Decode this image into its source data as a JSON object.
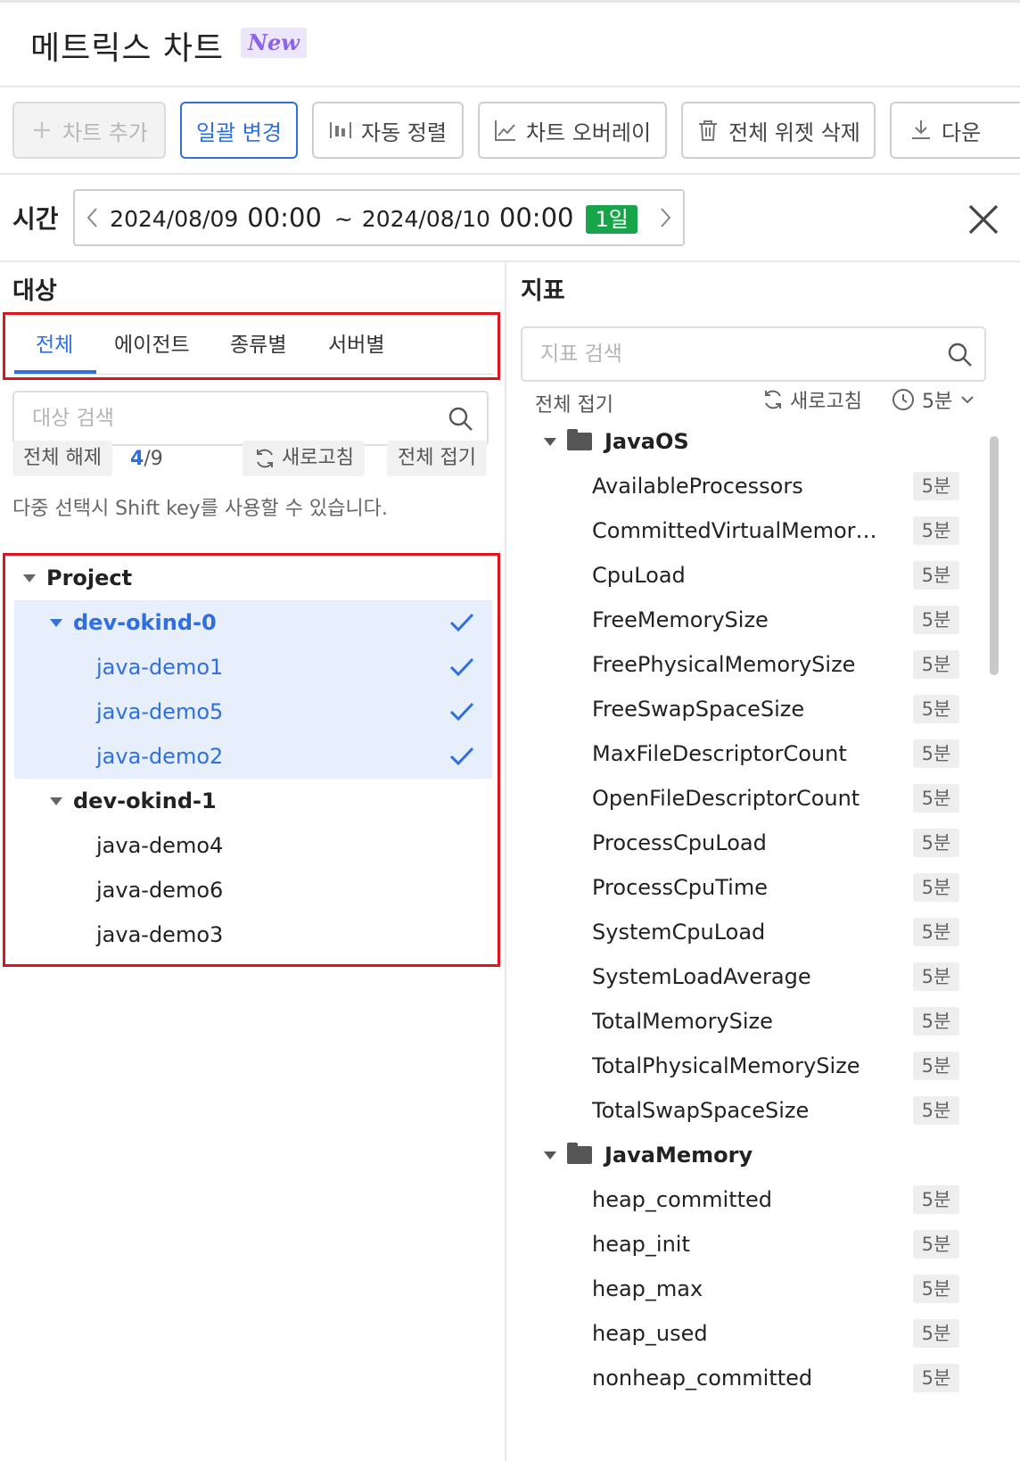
{
  "header": {
    "title": "메트릭스 차트",
    "badge": "New"
  },
  "toolbar": {
    "add_chart": "차트 추가",
    "bulk_change": "일괄 변경",
    "auto_sort": "자동 정렬",
    "chart_overlay": "차트 오버레이",
    "delete_all_widgets": "전체 위젯 삭제",
    "download": "다운"
  },
  "time": {
    "label": "시간",
    "start_date": "2024/08/09",
    "start_hm": "00:00",
    "separator": "~",
    "end_date": "2024/08/10",
    "end_hm": "00:00",
    "range_badge": "1일"
  },
  "target": {
    "title": "대상",
    "tabs": [
      "전체",
      "에이전트",
      "종류별",
      "서버별"
    ],
    "search_placeholder": "대상 검색",
    "deselect_all": "전체 해제",
    "count_selected": "4",
    "count_total": "/9",
    "refresh": "새로고침",
    "collapse_all": "전체 접기",
    "hint": "다중 선택시 Shift key를 사용할 수 있습니다.",
    "tree": {
      "root": "Project",
      "groups": [
        {
          "name": "dev-okind-0",
          "items": [
            "java-demo1",
            "java-demo5",
            "java-demo2"
          ]
        },
        {
          "name": "dev-okind-1",
          "items": [
            "java-demo4",
            "java-demo6",
            "java-demo3"
          ]
        }
      ]
    }
  },
  "metrics": {
    "title": "지표",
    "search_placeholder": "지표 검색",
    "collapse_all": "전체 접기",
    "refresh": "새로고침",
    "interval": "5분",
    "groups": [
      {
        "name": "JavaOS",
        "items": [
          "AvailableProcessors",
          "CommittedVirtualMemoryS...",
          "CpuLoad",
          "FreeMemorySize",
          "FreePhysicalMemorySize",
          "FreeSwapSpaceSize",
          "MaxFileDescriptorCount",
          "OpenFileDescriptorCount",
          "ProcessCpuLoad",
          "ProcessCpuTime",
          "SystemCpuLoad",
          "SystemLoadAverage",
          "TotalMemorySize",
          "TotalPhysicalMemorySize",
          "TotalSwapSpaceSize"
        ]
      },
      {
        "name": "JavaMemory",
        "items": [
          "heap_committed",
          "heap_init",
          "heap_max",
          "heap_used",
          "nonheap_committed"
        ]
      }
    ],
    "item_badge": "5분"
  },
  "colors": {
    "accent": "#2f6fe0",
    "badge_green": "#18a54a",
    "highlight": "#e0141c",
    "new_badge": "#8c62e6"
  }
}
